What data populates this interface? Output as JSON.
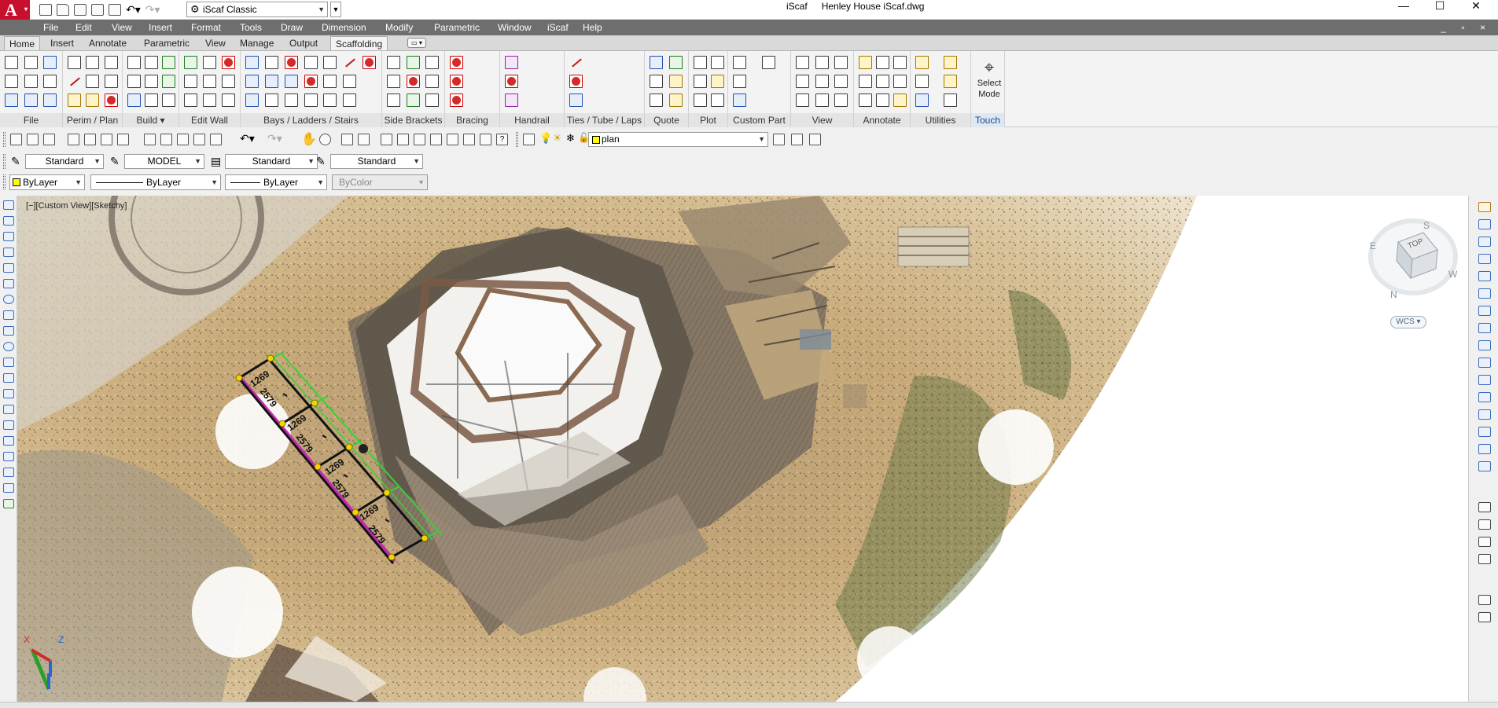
{
  "app": {
    "workspace": "iScaf Classic",
    "title_app": "iScaf",
    "title_doc": "Henley House iScaf.dwg",
    "window_controls": [
      "—",
      "☐",
      "✕"
    ],
    "doc_controls": "_ ▫ ×"
  },
  "menu": [
    "File",
    "Edit",
    "View",
    "Insert",
    "Format",
    "Tools",
    "Draw",
    "Dimension",
    "Modify",
    "Parametric",
    "Window",
    "iScaf",
    "Help"
  ],
  "ribbon_tabs": [
    "Home",
    "Insert",
    "Annotate",
    "Parametric",
    "View",
    "Manage",
    "Output",
    "Scaffolding"
  ],
  "ribbon_active_tab": "Scaffolding",
  "ribbon_panels": [
    {
      "label": "File"
    },
    {
      "label": "Perim / Plan"
    },
    {
      "label": "Build ▾"
    },
    {
      "label": "Edit Wall"
    },
    {
      "label": "Bays /  Ladders / Stairs"
    },
    {
      "label": "Side Brackets"
    },
    {
      "label": "Bracing"
    },
    {
      "label": "Handrail"
    },
    {
      "label": "Ties / Tube / Laps"
    },
    {
      "label": "Quote"
    },
    {
      "label": "Plot"
    },
    {
      "label": "Custom Part"
    },
    {
      "label": "View"
    },
    {
      "label": "Annotate"
    },
    {
      "label": "Utilities"
    },
    {
      "label": "Touch"
    }
  ],
  "select_mode": {
    "line1": "Select",
    "line2": "Mode",
    "icon": "crosshair-icon"
  },
  "toolbar_standard": {
    "layer_value": "plan"
  },
  "toolbar_styles": {
    "text_style": "Standard",
    "dim_scope": "MODEL",
    "dim_style": "Standard",
    "table_style": "Standard"
  },
  "toolbar_props": {
    "color": "ByLayer",
    "linetype": "ByLayer",
    "lineweight": "ByLayer",
    "plotstyle": "ByColor"
  },
  "viewport": {
    "label": "[−][Custom View][Sketchy]",
    "viewcube_face": "TOP",
    "compass": {
      "n": "N",
      "s": "S",
      "e": "E",
      "w": "W"
    },
    "wcs": "WCS ▾",
    "ucs": {
      "x": "X",
      "z": "Z"
    },
    "dimension_labels": [
      "1269",
      "2579",
      "1269",
      "2579",
      "1269",
      "2579",
      "1269",
      "2579"
    ]
  },
  "colors": {
    "app_red": "#c8102e",
    "menu_bg": "#6e6e6e",
    "layer_swatch": "#ffff00",
    "scaffold_green": "#35d335"
  }
}
